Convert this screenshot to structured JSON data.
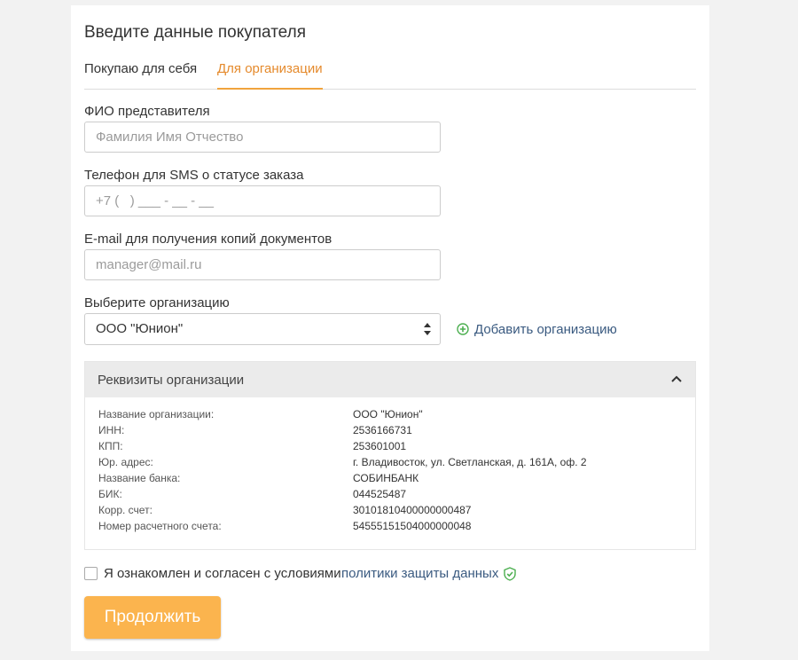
{
  "form": {
    "title": "Введите данные покупателя",
    "tabs": [
      {
        "label": "Покупаю для себя",
        "active": false
      },
      {
        "label": "Для организации",
        "active": true
      }
    ],
    "fio": {
      "label": "ФИО представителя",
      "placeholder": "Фамилия Имя Отчество",
      "value": ""
    },
    "phone": {
      "label": "Телефон для SMS о статусе заказа",
      "placeholder": "+7 (   ) ___ - __ - __",
      "value": ""
    },
    "email": {
      "label": "E-mail для получения копий документов",
      "placeholder": "manager@mail.ru",
      "value": ""
    },
    "organization": {
      "label": "Выберите организацию",
      "selected": "ООО \"Юнион\""
    },
    "add_org_label": "Добавить организацию"
  },
  "requisites": {
    "header": "Реквизиты организации",
    "expanded": true,
    "rows": [
      {
        "key": "Название организации:",
        "value": "ООО \"Юнион\""
      },
      {
        "key": "ИНН:",
        "value": "2536166731"
      },
      {
        "key": "КПП:",
        "value": "253601001"
      },
      {
        "key": "Юр. адрес:",
        "value": "г. Владивосток, ул. Светланская, д. 161А, оф. 2"
      },
      {
        "key": "Название банка:",
        "value": "СОБИНБАНК"
      },
      {
        "key": "БИК:",
        "value": "044525487"
      },
      {
        "key": "Корр. счет:",
        "value": "30101810400000000487"
      },
      {
        "key": "Номер расчетного счета:",
        "value": "54555151504000000048"
      }
    ]
  },
  "agreement": {
    "text": "Я ознакомлен и согласен с условиями",
    "link": "политики защиты данных",
    "checked": false
  },
  "submit_label": "Продолжить",
  "colors": {
    "accent": "#f0a33d",
    "link": "#3a5a80",
    "button": "#fbb44e",
    "add_icon": "#4caf50",
    "shield": "#4caf50"
  }
}
